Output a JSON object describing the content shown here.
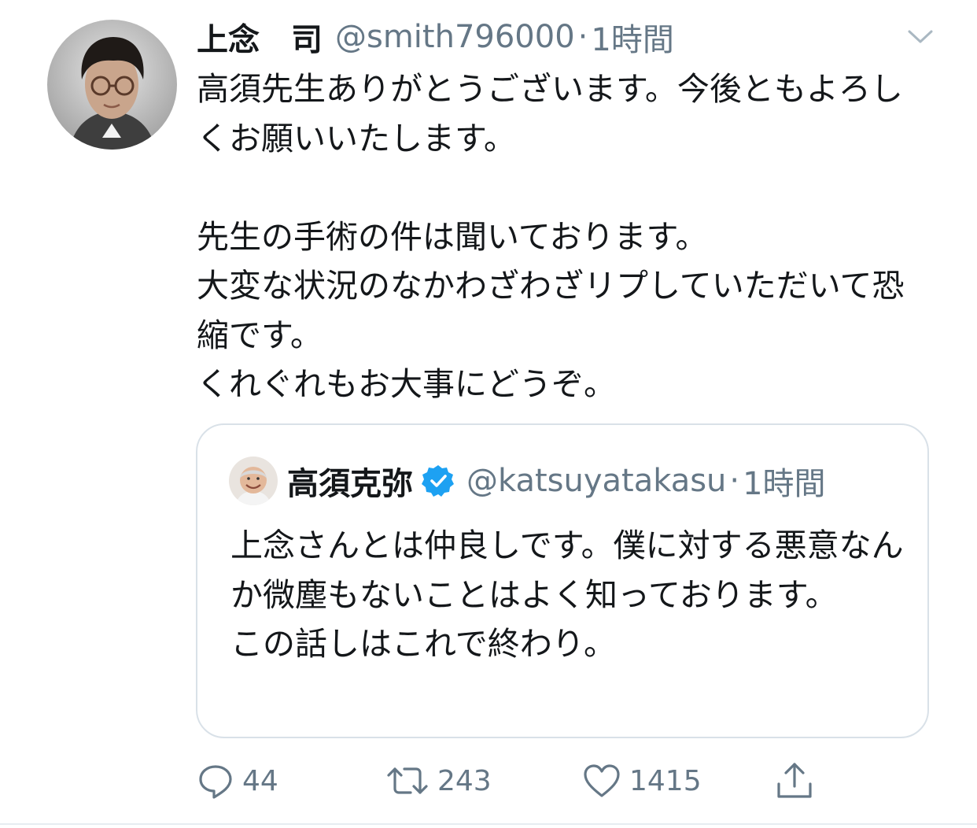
{
  "tweet": {
    "author_name": "上念　司",
    "author_handle": "@smith796000",
    "separator": "·",
    "time": "1時間",
    "text": "高須先生ありがとうございます。今後ともよろしくお願いいたします。\n\n先生の手術の件は聞いております。\n大変な状況のなかわざわざリプしていただいて恐縮です。\nくれぐれもお大事にどうぞ。"
  },
  "quoted_tweet": {
    "author_name": "高須克弥",
    "verified": true,
    "author_handle": "@katsuyatakasu",
    "separator": "·",
    "time": "1時間",
    "text": "上念さんとは仲良しです。僕に対する悪意なんか微塵もないことはよく知っております。\nこの話しはこれで終わり。"
  },
  "actions": {
    "reply_count": "44",
    "retweet_count": "243",
    "like_count": "1415"
  },
  "icons": {
    "menu": "chevron-down-icon",
    "reply": "comment-bubble-icon",
    "retweet": "retweet-arrows-icon",
    "like": "heart-icon",
    "share": "share-upload-icon",
    "verified": "verified-badge-icon"
  },
  "colors": {
    "text": "#14171a",
    "secondary": "#657786",
    "border": "#d9e1e8",
    "verified": "#1da1f2"
  }
}
